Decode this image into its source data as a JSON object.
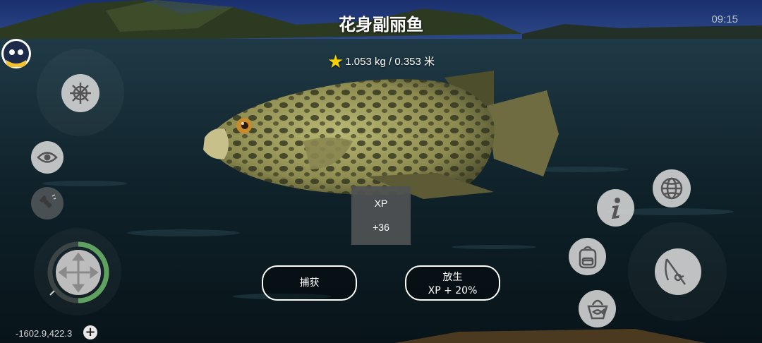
{
  "fish": {
    "name": "花身副丽鱼",
    "weight_length": "1.053 kg / 0.353 米"
  },
  "status": {
    "time": "09:15"
  },
  "reward": {
    "label": "XP",
    "value": "+36"
  },
  "actions": {
    "catch_label": "捕获",
    "release_label_line1": "放生",
    "release_label_line2": "XP + 20%"
  },
  "hud": {
    "coordinates": "-1602.9,422.3",
    "add_symbol": "+"
  },
  "icons": {
    "left": [
      "avatar-icon",
      "ship-wheel-icon",
      "eye-icon",
      "flashlight-icon",
      "move-joystick-icon"
    ],
    "right": [
      "globe-icon",
      "info-icon",
      "backpack-icon",
      "fish-basket-icon",
      "fishing-rod-icon"
    ]
  },
  "colors": {
    "star": "#f6d000",
    "joystick_ring": "#5fa25f",
    "button_border": "#ffffff"
  }
}
